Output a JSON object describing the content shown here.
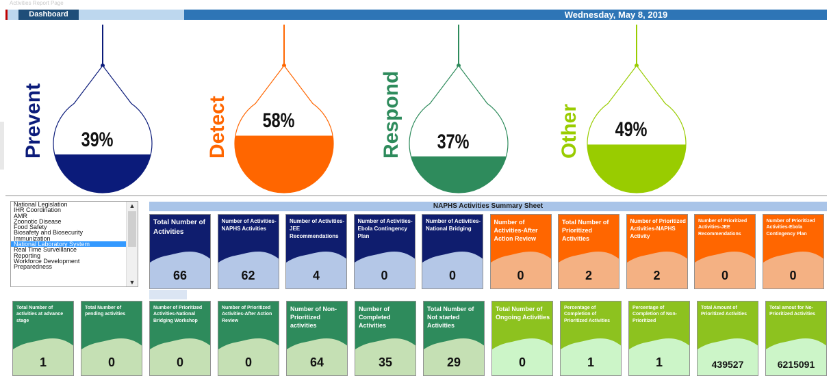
{
  "header": {
    "dashboard_button": "Dashboard",
    "date": "Wednesday, May 8, 2019"
  },
  "gauges": [
    {
      "category": "Prevent",
      "percent_label": "39%",
      "fill_fraction": 0.39,
      "color": "#0b1b7a"
    },
    {
      "category": "Detect",
      "percent_label": "58%",
      "fill_fraction": 0.58,
      "color": "#ff6600"
    },
    {
      "category": "Respond",
      "percent_label": "37%",
      "fill_fraction": 0.37,
      "color": "#2e8b5c"
    },
    {
      "category": "Other",
      "percent_label": "49%",
      "fill_fraction": 0.49,
      "color": "#99cc00"
    }
  ],
  "list": {
    "items": [
      "National Legislation",
      "IHR Coordination",
      "AMR",
      "Zoonotic Disease",
      "Food Safety",
      "Biosafety and Biosecurity",
      "Immunization",
      "National Laboratory System",
      "Real Time Surveillance",
      "Reporting",
      "Workforce Development",
      "Preparedness"
    ],
    "selected_index": 7
  },
  "summary": {
    "title": "NAPHS Activities Summary Sheet",
    "row1": [
      {
        "label": "Total Number of Activities",
        "value": "66",
        "theme": "blue",
        "size": 10
      },
      {
        "label": "Number of Activities- NAPHS Activities",
        "value": "62",
        "theme": "blue",
        "size": 8
      },
      {
        "label": "Number of Activities-JEE Recommendations",
        "value": "4",
        "theme": "blue",
        "size": 8
      },
      {
        "label": "Number of Activities-Ebola Contingency Plan",
        "value": "0",
        "theme": "blue",
        "size": 8
      },
      {
        "label": "Number of Activities-National Bridging",
        "value": "0",
        "theme": "blue",
        "size": 8
      },
      {
        "label": "Number of Activities-After Action Review",
        "value": "0",
        "theme": "orange",
        "size": 9
      },
      {
        "label": "Total Number of Prioritized Activities",
        "value": "2",
        "theme": "orange",
        "size": 9
      },
      {
        "label": "Number of Prioritized Activities-NAPHS Activity",
        "value": "2",
        "theme": "orange",
        "size": 8
      },
      {
        "label": "Number of Prioritized Activities-JEE Recommendations",
        "value": "0",
        "theme": "orange",
        "size": 7
      },
      {
        "label": "Number of Prioritized Activities-Ebola Contingency Plan",
        "value": "0",
        "theme": "orange",
        "size": 7
      }
    ],
    "row2": [
      {
        "label": "Total Number of activities at advance stage",
        "value": "1",
        "theme": "green",
        "size": 7
      },
      {
        "label": "Total Number of pending activities",
        "value": "0",
        "theme": "green",
        "size": 7
      },
      {
        "label": "Number of Prioritized Activities-National Bridging Workshop",
        "value": "0",
        "theme": "green",
        "size": 7
      },
      {
        "label": "Number of Prioritized Activities-After Action Review",
        "value": "0",
        "theme": "green",
        "size": 7
      },
      {
        "label": "Number of Non-Prioritized activities",
        "value": "64",
        "theme": "green",
        "size": 9
      },
      {
        "label": "Number of Completed Activities",
        "value": "35",
        "theme": "green",
        "size": 9
      },
      {
        "label": "Total Number of Not started Activities",
        "value": "29",
        "theme": "green",
        "size": 9
      },
      {
        "label": "Total Number of Ongoing Activities",
        "value": "0",
        "theme": "lime",
        "size": 9
      },
      {
        "label": "Percentage of Completion of Prioritized Activities",
        "value": "1",
        "theme": "lime",
        "size": 7
      },
      {
        "label": "Percentage of Completion of Non-Prioritized",
        "value": "1",
        "theme": "lime",
        "size": 7
      },
      {
        "label": "Total Amount of Prioritized Activities",
        "value": "439527",
        "theme": "lime",
        "size": 7
      },
      {
        "label": "Total amout for No-Prioritized Activities",
        "value": "6215091",
        "theme": "lime",
        "size": 7
      }
    ]
  },
  "colors": {
    "blue_top": "#0f1d6e",
    "blue_bottom": "#b4c7e7",
    "orange_top": "#ff6600",
    "orange_bottom": "#f4b183",
    "green_top": "#2e8b5c",
    "green_bottom": "#c5e0b4",
    "lime_top": "#8dc21f",
    "lime_bottom": "#ccf5c8"
  }
}
